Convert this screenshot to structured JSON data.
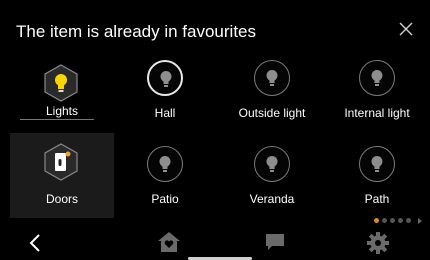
{
  "header": {
    "title": "The item is already in favourites",
    "close_icon": "close-icon"
  },
  "categories": [
    {
      "label": "Lights",
      "icon": "bulb-icon",
      "selected": false,
      "accent": "#f7d600"
    },
    {
      "label": "Doors",
      "icon": "door-lock-icon",
      "selected": true,
      "accent": "#f0a030"
    }
  ],
  "devices": [
    {
      "label": "Hall",
      "icon": "bulb-icon",
      "active": true
    },
    {
      "label": "Outside light",
      "icon": "bulb-icon",
      "active": false
    },
    {
      "label": "Internal light",
      "icon": "bulb-icon",
      "active": false
    },
    {
      "label": "Patio",
      "icon": "bulb-icon",
      "active": false
    },
    {
      "label": "Veranda",
      "icon": "bulb-icon",
      "active": false
    },
    {
      "label": "Path",
      "icon": "bulb-icon",
      "active": false
    }
  ],
  "pagination": {
    "current_page": 1,
    "total_pages": 5,
    "accent": "#e08a1e"
  },
  "bottom_nav": [
    {
      "name": "back",
      "icon": "chevron-left-icon"
    },
    {
      "name": "home",
      "icon": "home-heart-icon"
    },
    {
      "name": "messages",
      "icon": "chat-bubble-icon"
    },
    {
      "name": "settings",
      "icon": "gear-icon"
    }
  ]
}
